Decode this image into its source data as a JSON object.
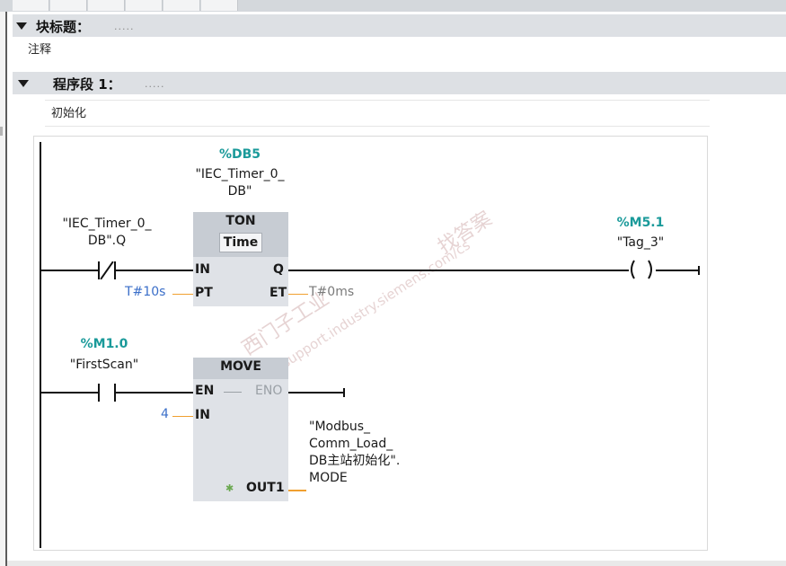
{
  "block_title": {
    "label": "块标题：",
    "dots": "....."
  },
  "block_comment": "注释",
  "network": {
    "label": "程序段 1：",
    "dots": ".....",
    "comment": "初始化"
  },
  "rung1": {
    "contact_tag_line1": "\"IEC_Timer_0_",
    "contact_tag_line2": "DB\".Q",
    "timer_db_addr": "%DB5",
    "timer_db_line1": "\"IEC_Timer_0_",
    "timer_db_line2": "DB\"",
    "box_title": "TON",
    "box_type": "Time",
    "pin_in": "IN",
    "pin_pt": "PT",
    "pin_q": "Q",
    "pin_et": "ET",
    "pt_value": "T#10s",
    "et_value": "T#0ms",
    "coil_addr": "%M5.1",
    "coil_tag": "\"Tag_3\"",
    "coil_symbol": "( )"
  },
  "rung2": {
    "contact_addr": "%M1.0",
    "contact_tag": "\"FirstScan\"",
    "box_title": "MOVE",
    "pin_en": "EN",
    "pin_eno": "ENO",
    "pin_in": "IN",
    "pin_out1": "OUT1",
    "in_value": "4",
    "out_line1": "\"Modbus_",
    "out_line2": "Comm_Load_",
    "out_line3": "DB主站初始化\".",
    "out_line4": "MODE"
  },
  "watermark": {
    "line1": "西门子工业",
    "line2": "support.industry.siemens.com/cs",
    "line3": "找答案"
  },
  "colors": {
    "address": "#1a9a9a",
    "constant": "#3b6fc9",
    "box_fill": "#dfe2e7",
    "header_fill": "#dde0e4",
    "wire_orange": "#f0a030"
  }
}
